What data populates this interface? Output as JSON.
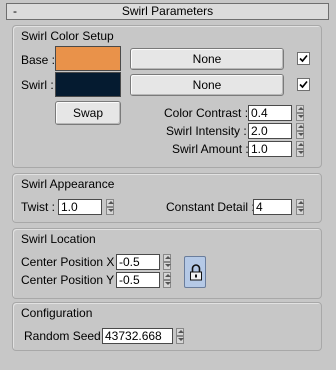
{
  "rollout": {
    "minus": "-",
    "title": "Swirl Parameters"
  },
  "color_setup": {
    "title": "Swirl Color Setup",
    "base_label": "Base :",
    "swirl_label": "Swirl :",
    "base_color": "#e9924a",
    "swirl_color": "#051b30",
    "base_map_button": "None",
    "swirl_map_button": "None",
    "swap_button": "Swap",
    "color_contrast_label": "Color Contrast :",
    "color_contrast_value": "0.4",
    "swirl_intensity_label": "Swirl Intensity :",
    "swirl_intensity_value": "2.0",
    "swirl_amount_label": "Swirl Amount :",
    "swirl_amount_value": "1.0"
  },
  "appearance": {
    "title": "Swirl Appearance",
    "twist_label": "Twist :",
    "twist_value": "1.0",
    "constant_detail_label": "Constant Detail :",
    "constant_detail_value": "4"
  },
  "location": {
    "title": "Swirl Location",
    "center_x_label": "Center Position X :",
    "center_x_value": "-0.5",
    "center_y_label": "Center Position Y :",
    "center_y_value": "-0.5",
    "lock_icon": "lock-icon"
  },
  "configuration": {
    "title": "Configuration",
    "random_seed_label": "Random Seed :",
    "random_seed_value": "43732.668"
  }
}
